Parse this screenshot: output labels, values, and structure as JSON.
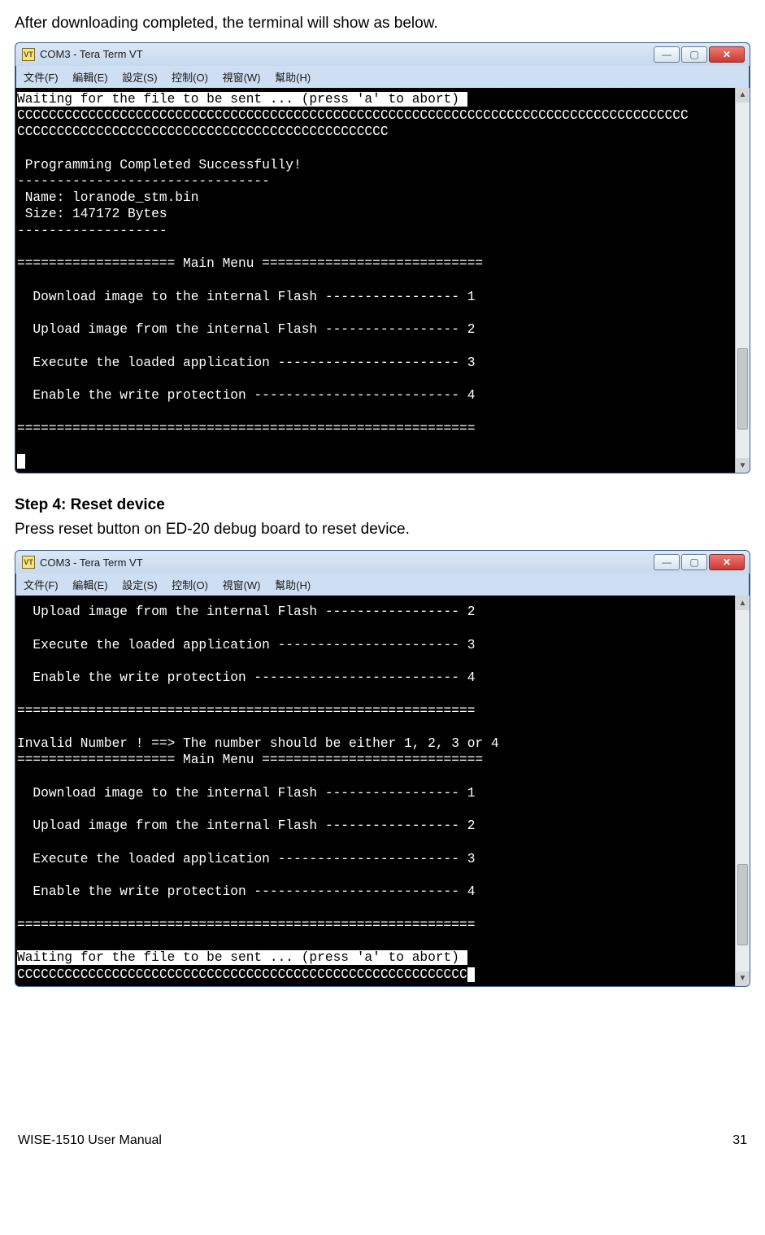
{
  "intro": "After downloading completed, the terminal will show as below.",
  "step4": {
    "heading": "Step 4: Reset device",
    "body": "Press reset button on ED-20 debug board to reset device."
  },
  "window": {
    "icon_label": "VT",
    "title": "COM3 - Tera Term VT",
    "btn_min": "—",
    "btn_max": "▢",
    "btn_close": "✕",
    "menu": {
      "file": "文件(F)",
      "edit": "編輯(E)",
      "setup": "設定(S)",
      "control": "控制(O)",
      "window": "視窗(W)",
      "help": "幫助(H)"
    }
  },
  "term1": {
    "l1": "Waiting for the file to be sent ... (press 'a' to abort) ",
    "l2": "CCCCCCCCCCCCCCCCCCCCCCCCCCCCCCCCCCCCCCCCCCCCCCCCCCCCCCCCCCCCCCCCCCCCCCCCCCCCCCCCCCCCC",
    "l3": "CCCCCCCCCCCCCCCCCCCCCCCCCCCCCCCCCCCCCCCCCCCCCCC",
    "l4": "",
    "l5": " Programming Completed Successfully!",
    "l6": "--------------------------------",
    "l7": " Name: loranode_stm.bin",
    "l8": " Size: 147172 Bytes",
    "l9": "-------------------",
    "l10": "",
    "l11": "==================== Main Menu ============================",
    "l12": "",
    "l13": "  Download image to the internal Flash ----------------- 1",
    "l14": "",
    "l15": "  Upload image from the internal Flash ----------------- 2",
    "l16": "",
    "l17": "  Execute the loaded application ----------------------- 3",
    "l18": "",
    "l19": "  Enable the write protection -------------------------- 4",
    "l20": "",
    "l21": "==========================================================",
    "l22": "",
    "cursor": " "
  },
  "term2": {
    "l1": "  Upload image from the internal Flash ----------------- 2",
    "l2": "",
    "l3": "  Execute the loaded application ----------------------- 3",
    "l4": "",
    "l5": "  Enable the write protection -------------------------- 4",
    "l6": "",
    "l7": "==========================================================",
    "l8": "",
    "l9": "Invalid Number ! ==> The number should be either 1, 2, 3 or 4",
    "l10": "==================== Main Menu ============================",
    "l11": "",
    "l12": "  Download image to the internal Flash ----------------- 1",
    "l13": "",
    "l14": "  Upload image from the internal Flash ----------------- 2",
    "l15": "",
    "l16": "  Execute the loaded application ----------------------- 3",
    "l17": "",
    "l18": "  Enable the write protection -------------------------- 4",
    "l19": "",
    "l20": "==========================================================",
    "l21": "",
    "l22": "Waiting for the file to be sent ... (press 'a' to abort) ",
    "l23": "CCCCCCCCCCCCCCCCCCCCCCCCCCCCCCCCCCCCCCCCCCCCCCCCCCCCCCCCC"
  },
  "footer": {
    "left": "WISE-1510 User Manual",
    "right": "31"
  }
}
